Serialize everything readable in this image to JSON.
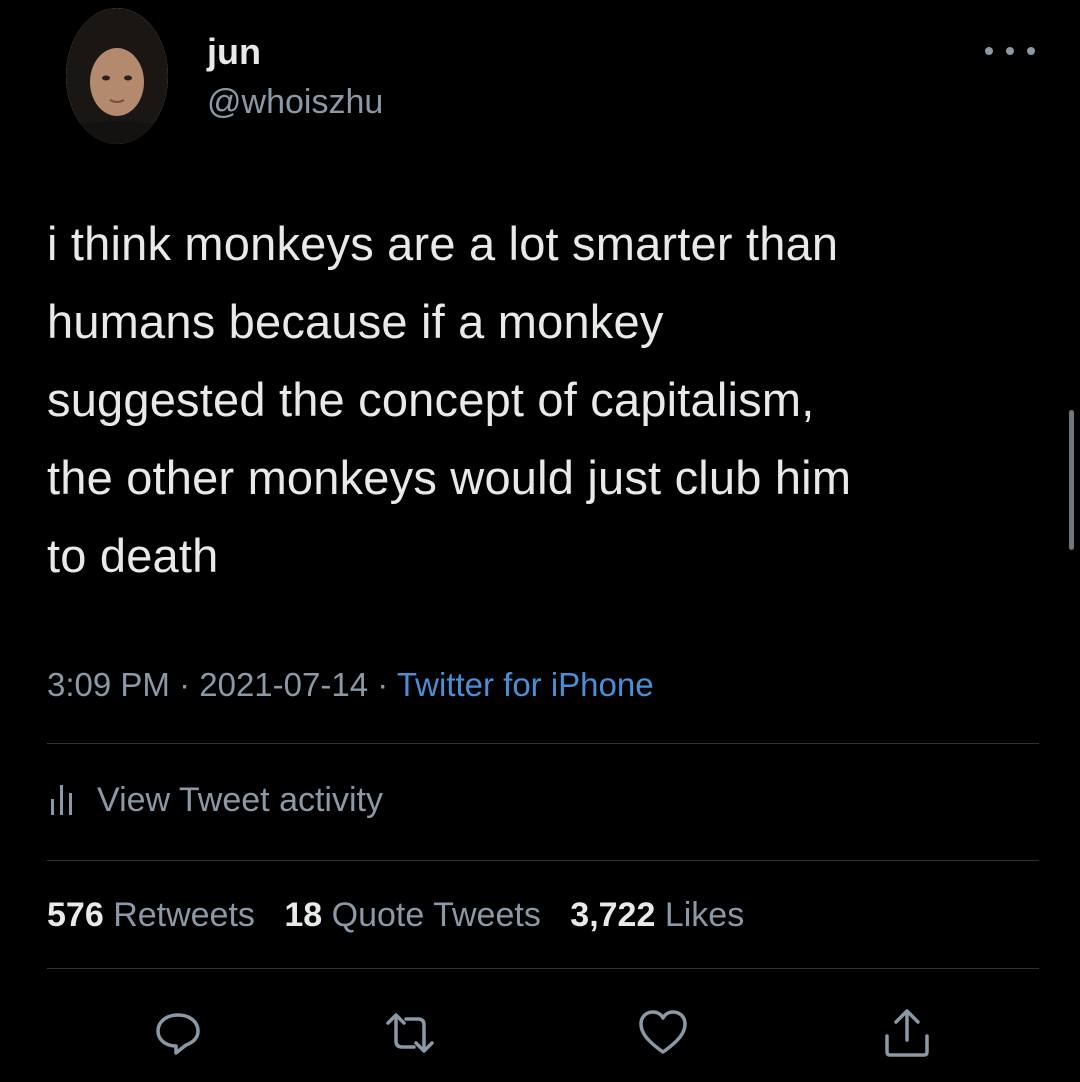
{
  "user": {
    "name": "jun",
    "handle": "@whoiszhu"
  },
  "tweet": {
    "lines": [
      "i think monkeys are a lot smarter than",
      "humans because if a monkey",
      "suggested the concept of capitalism,",
      "the other monkeys would just club him",
      "to death"
    ],
    "time": "3:09 PM",
    "separator": "·",
    "date": "2021-07-14",
    "source": "Twitter for iPhone"
  },
  "activity": {
    "label": "View Tweet activity",
    "icon": "bar-chart-icon"
  },
  "stats": {
    "retweets_count": "576",
    "retweets_label": "Retweets",
    "quotes_count": "18",
    "quotes_label": "Quote Tweets",
    "likes_count": "3,722",
    "likes_label": "Likes"
  },
  "actions": {
    "icons": [
      "reply-icon",
      "retweet-icon",
      "like-icon",
      "share-icon"
    ]
  },
  "colors": {
    "background": "#000000",
    "primary_text": "#e7e9ea",
    "secondary_text": "#8b98a5",
    "link": "#4a8fd6",
    "divider": "#2f3336"
  }
}
